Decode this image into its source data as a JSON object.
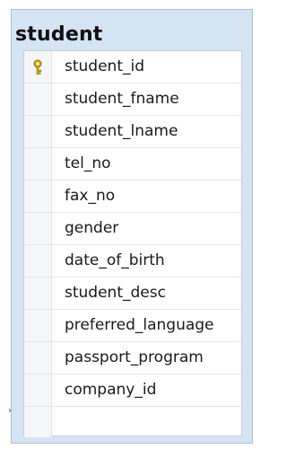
{
  "table": {
    "name": "student",
    "columns": [
      {
        "name": "student_id",
        "primary_key": true
      },
      {
        "name": "student_fname",
        "primary_key": false
      },
      {
        "name": "student_lname",
        "primary_key": false
      },
      {
        "name": "tel_no",
        "primary_key": false
      },
      {
        "name": "fax_no",
        "primary_key": false
      },
      {
        "name": "gender",
        "primary_key": false
      },
      {
        "name": "date_of_birth",
        "primary_key": false
      },
      {
        "name": "student_desc",
        "primary_key": false
      },
      {
        "name": "preferred_language",
        "primary_key": false
      },
      {
        "name": "passport_program",
        "primary_key": false
      },
      {
        "name": "company_id",
        "primary_key": false
      }
    ]
  },
  "icons": {
    "primary_key": "key-icon"
  },
  "colors": {
    "window_background": "#d4e4f3",
    "key_icon": "#d8b21a"
  }
}
